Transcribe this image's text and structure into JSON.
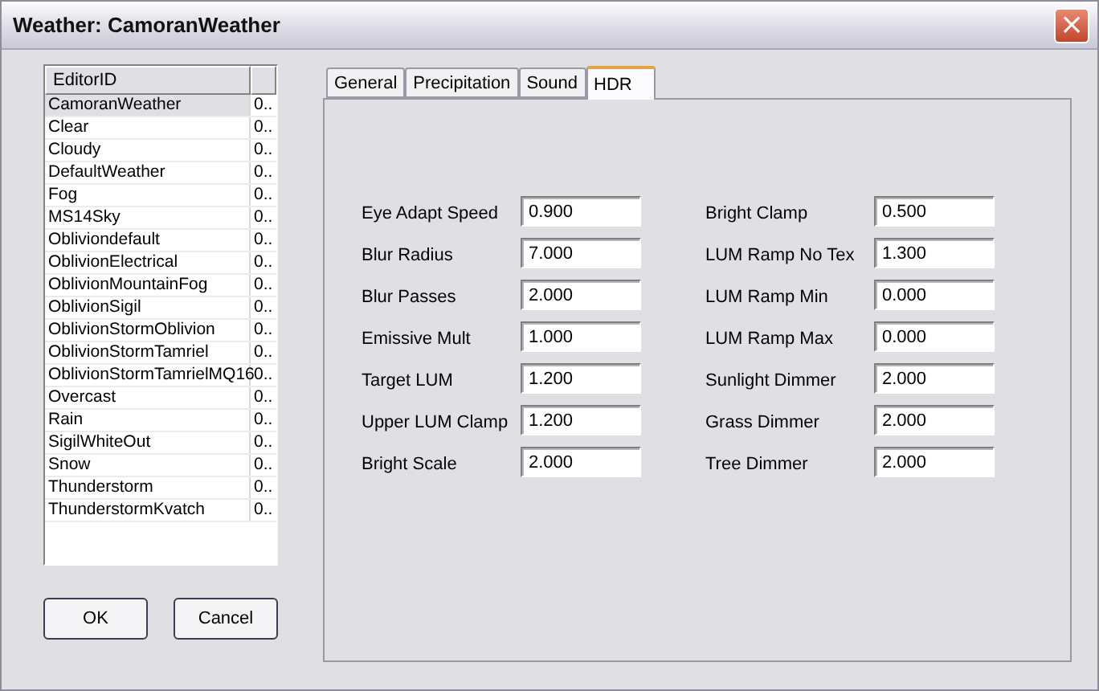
{
  "window": {
    "title": "Weather: CamoranWeather",
    "close_button": "×"
  },
  "list": {
    "columns": [
      "EditorID",
      ""
    ],
    "rows": [
      {
        "name": "CamoranWeather",
        "column_2": "0..",
        "selected": true
      },
      {
        "name": "Clear",
        "column_2": "0..",
        "selected": false
      },
      {
        "name": "Cloudy",
        "column_2": "0..",
        "selected": false
      },
      {
        "name": "DefaultWeather",
        "column_2": "0..",
        "selected": false
      },
      {
        "name": "Fog",
        "column_2": "0..",
        "selected": false
      },
      {
        "name": "MS14Sky",
        "column_2": "0..",
        "selected": false
      },
      {
        "name": "Obliviondefault",
        "column_2": "0..",
        "selected": false
      },
      {
        "name": "OblivionElectrical",
        "column_2": "0..",
        "selected": false
      },
      {
        "name": "OblivionMountainFog",
        "column_2": "0..",
        "selected": false
      },
      {
        "name": "OblivionSigil",
        "column_2": "0..",
        "selected": false
      },
      {
        "name": "OblivionStormOblivion",
        "column_2": "0..",
        "selected": false
      },
      {
        "name": "OblivionStormTamriel",
        "column_2": "0..",
        "selected": false
      },
      {
        "name": "OblivionStormTamrielMQ16",
        "column_2": "0..",
        "selected": false
      },
      {
        "name": "Overcast",
        "column_2": "0..",
        "selected": false
      },
      {
        "name": "Rain",
        "column_2": "0..",
        "selected": false
      },
      {
        "name": "SigilWhiteOut",
        "column_2": "0..",
        "selected": false
      },
      {
        "name": "Snow",
        "column_2": "0..",
        "selected": false
      },
      {
        "name": "Thunderstorm",
        "column_2": "0..",
        "selected": false
      },
      {
        "name": "ThunderstormKvatch",
        "column_2": "0..",
        "selected": false
      }
    ]
  },
  "buttons": [
    "OK",
    "Cancel"
  ],
  "tabs": [
    {
      "label": "General",
      "selected": false
    },
    {
      "label": "Precipitation",
      "selected": false
    },
    {
      "label": "Sound",
      "selected": false
    },
    {
      "label": "HDR",
      "selected": true
    }
  ],
  "hdr_left": [
    {
      "label": "Eye Adapt Speed",
      "value": "0.900"
    },
    {
      "label": "Blur Radius",
      "value": "7.000"
    },
    {
      "label": "Blur Passes",
      "value": "2.000"
    },
    {
      "label": "Emissive Mult",
      "value": "1.000"
    },
    {
      "label": "Target LUM",
      "value": "1.200"
    },
    {
      "label": "Upper LUM Clamp",
      "value": "1.200"
    },
    {
      "label": "Bright Scale",
      "value": "2.000"
    }
  ],
  "hdr_right": [
    {
      "label": "Bright Clamp",
      "value": "0.500"
    },
    {
      "label": "LUM Ramp No Tex",
      "value": "1.300"
    },
    {
      "label": "LUM Ramp Min",
      "value": "0.000"
    },
    {
      "label": "LUM Ramp Max",
      "value": "0.000"
    },
    {
      "label": "Sunlight Dimmer",
      "value": "2.000"
    },
    {
      "label": "Grass Dimmer",
      "value": "2.000"
    },
    {
      "label": "Tree Dimmer",
      "value": "2.000"
    }
  ]
}
